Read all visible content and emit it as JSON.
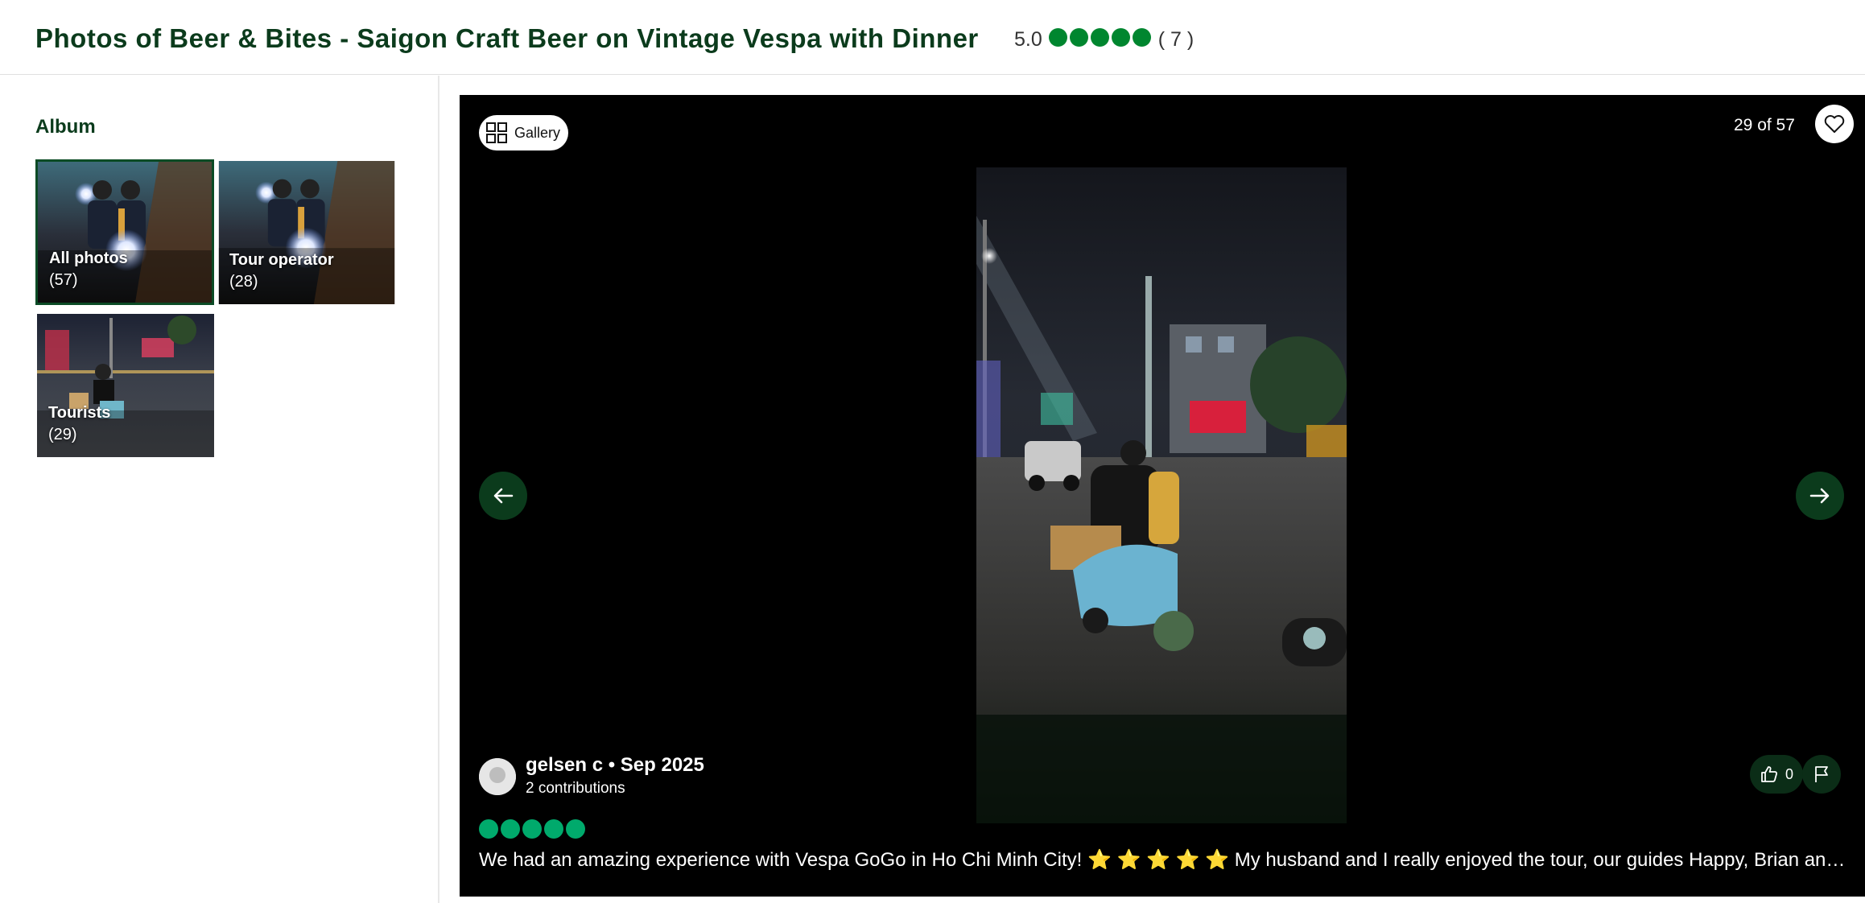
{
  "header": {
    "title": "Photos of Beer & Bites - Saigon Craft Beer on Vintage Vespa with Dinner",
    "rating": "5.0",
    "rating_bubbles": 5,
    "review_count": "( 7 )"
  },
  "sidebar": {
    "album_title": "Album",
    "albums": [
      {
        "name": "All photos",
        "count": "(57)",
        "selected": true
      },
      {
        "name": "Tour operator",
        "count": "(28)",
        "selected": false
      },
      {
        "name": "Tourists",
        "count": "(29)",
        "selected": false
      }
    ]
  },
  "viewer": {
    "gallery_label": "Gallery",
    "counter": "29 of 57",
    "author": {
      "name_date": "gelsen c • Sep 2025",
      "contributions": "2 contributions"
    },
    "review_rating": 5,
    "review_text_before": "We had an amazing experience with Vespa GoGo in Ho Chi Minh City!",
    "review_stars": "⭐ ⭐ ⭐ ⭐ ⭐",
    "review_text_after": "My husband and I really enjoyed the tour, our guides Happy, Brian an…",
    "helpful_count": "0"
  },
  "colors": {
    "brand_dark_green": "#0b3b1c",
    "bubble_green": "#00aa6c",
    "viewer_bg": "#000000"
  },
  "icons": [
    "gallery-grid-icon",
    "heart-icon",
    "arrow-left-icon",
    "arrow-right-icon",
    "thumbs-up-icon",
    "flag-icon",
    "avatar-placeholder-icon"
  ]
}
